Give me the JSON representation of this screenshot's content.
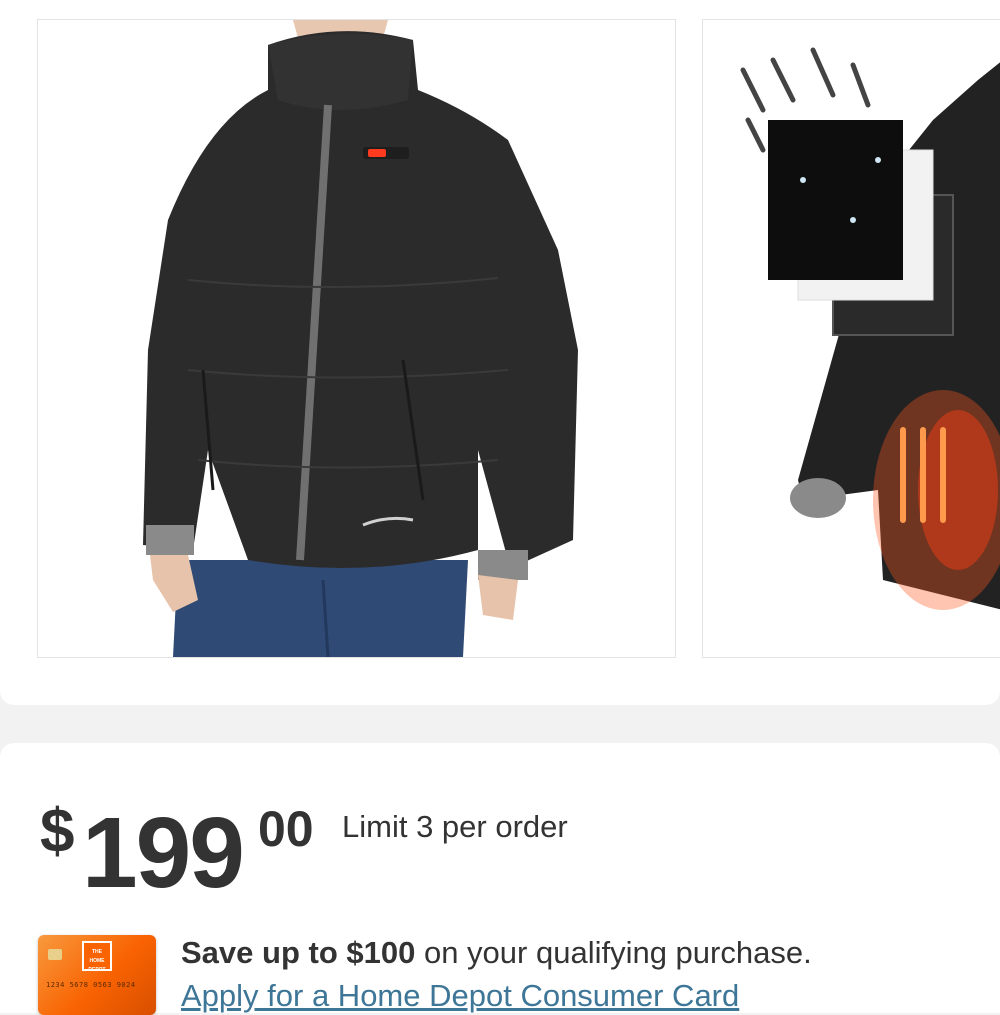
{
  "gallery": {
    "images": [
      {
        "alt": "Women's black heated jacket front view",
        "icon": "jacket-front-image"
      },
      {
        "alt": "Heated jacket layers and heating zones",
        "icon": "jacket-layers-image"
      }
    ]
  },
  "pricing": {
    "currency_symbol": "$",
    "dollars": "199",
    "cents": "00",
    "limit_text": "Limit 3 per order"
  },
  "promo": {
    "card_number": "1234 5678 0563 9024",
    "card_logo": "THE HOME DEPOT",
    "save_bold": "Save up to $100",
    "save_rest": " on your qualifying purchase.",
    "apply_link": "Apply for a Home Depot Consumer Card"
  },
  "colors": {
    "brand_orange": "#f96302",
    "link_blue": "#3e7697",
    "text": "#333333"
  }
}
